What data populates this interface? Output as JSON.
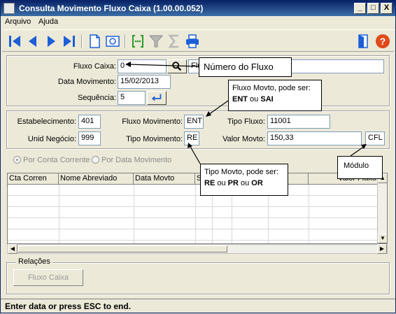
{
  "window": {
    "title": "Consulta Movimento Fluxo Caixa (1.00.00.052)",
    "minimize": "_",
    "maximize": "□",
    "close": "X"
  },
  "menu": {
    "items": [
      {
        "label": "Arquivo"
      },
      {
        "label": "Ajuda"
      }
    ]
  },
  "toolbar": {
    "icons": [
      "first-record-icon",
      "prev-record-icon",
      "next-record-icon",
      "last-record-icon",
      "new-document-icon",
      "preview-icon",
      "select-icon",
      "filter-icon",
      "sum-icon",
      "print-icon",
      "exit-door-icon",
      "help-icon"
    ]
  },
  "form": {
    "fluxo_caixa": {
      "label": "Fluxo Caixa:",
      "value": "0",
      "desc_value": "Flu"
    },
    "data_movimento": {
      "label": "Data Movimento:",
      "value": "15/02/2013"
    },
    "sequencia": {
      "label": "Sequência:",
      "value": "5"
    },
    "estabelecimento": {
      "label": "Estabelecimento:",
      "value": "401"
    },
    "unid_negocio": {
      "label": "Unid Negócio:",
      "value": "999"
    },
    "fluxo_movimento": {
      "label": "Fluxo Movimento:",
      "value": "ENT"
    },
    "tipo_movimento": {
      "label": "Tipo Movimento:",
      "value": "RE"
    },
    "tipo_fluxo": {
      "label": "Tipo Fluxo:",
      "value": "11001"
    },
    "valor_movto": {
      "label": "Valor Movto:",
      "value": "150,33"
    },
    "modulo": {
      "value": "CFL"
    }
  },
  "radios": [
    {
      "label": "Por Conta Corrente",
      "checked": true
    },
    {
      "label": "Por Data Movimento",
      "checked": false
    }
  ],
  "grid": {
    "headers": [
      "Cta Corren",
      "Nome Abreviado",
      "Data Movto",
      "S",
      "",
      "",
      "",
      "Valor Fluxo"
    ]
  },
  "relacoes": {
    "legend": "Relações",
    "button": "Fluxo Caixa"
  },
  "callouts": {
    "numero_fluxo": "Número do Fluxo",
    "fluxo_movto_line1": "Fluxo Movto, pode ser:",
    "fluxo_movto_ent": "ENT",
    "fluxo_movto_ou": " ou ",
    "fluxo_movto_sai": "SAI",
    "tipo_movto_line1": "Tipo Movto, pode ser:",
    "tipo_movto_re": "RE",
    "tipo_movto_ou1": " ou ",
    "tipo_movto_pr": "PR",
    "tipo_movto_ou2": " ou ",
    "tipo_movto_or": "OR",
    "modulo": "Módulo"
  },
  "status": {
    "text": "Enter data or press ESC to end."
  },
  "colors": {
    "title_start": "#0a246a",
    "title_end": "#3a6ea5",
    "nav_blue": "#1c5fd6",
    "help_red": "#e04a1a"
  }
}
